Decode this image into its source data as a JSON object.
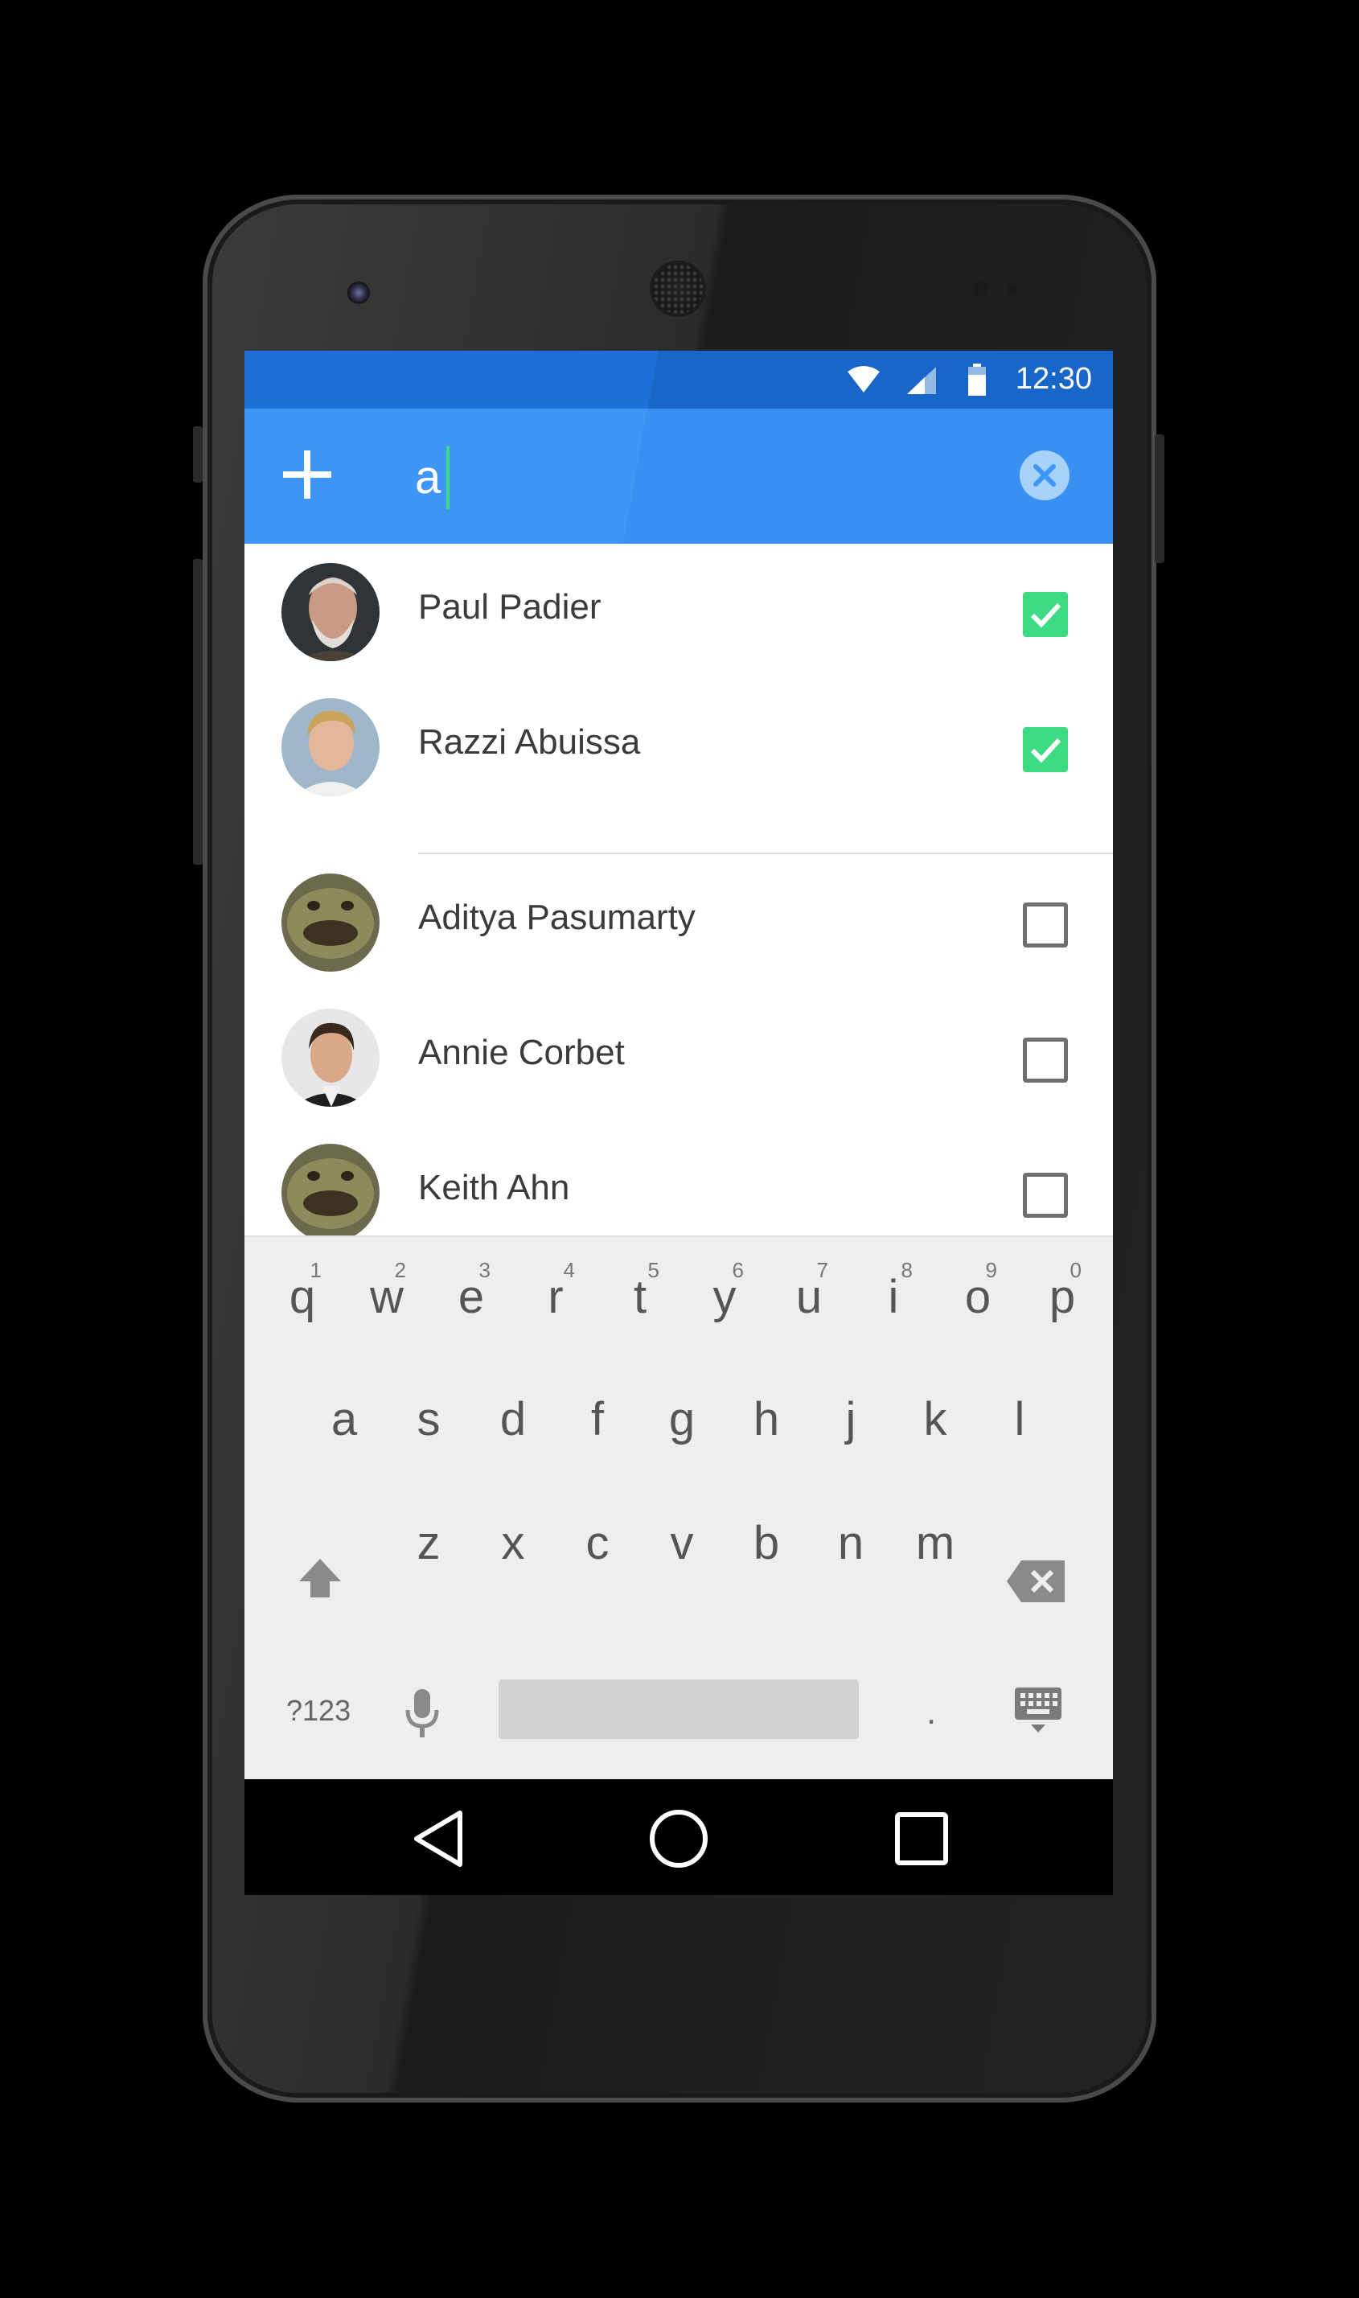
{
  "status_bar": {
    "time": "12:30"
  },
  "search": {
    "value": "a"
  },
  "contacts": [
    {
      "name": "Paul Padier",
      "checked": true
    },
    {
      "name": "Razzi Abuissa",
      "checked": true
    },
    {
      "name": "Aditya Pasumarty",
      "checked": false
    },
    {
      "name": "Annie Corbet",
      "checked": false
    },
    {
      "name": "Keith Ahn",
      "checked": false
    }
  ],
  "keyboard": {
    "row1": [
      {
        "ch": "q",
        "hint": "1"
      },
      {
        "ch": "w",
        "hint": "2"
      },
      {
        "ch": "e",
        "hint": "3"
      },
      {
        "ch": "r",
        "hint": "4"
      },
      {
        "ch": "t",
        "hint": "5"
      },
      {
        "ch": "y",
        "hint": "6"
      },
      {
        "ch": "u",
        "hint": "7"
      },
      {
        "ch": "i",
        "hint": "8"
      },
      {
        "ch": "o",
        "hint": "9"
      },
      {
        "ch": "p",
        "hint": "0"
      }
    ],
    "row2": [
      "a",
      "s",
      "d",
      "f",
      "g",
      "h",
      "j",
      "k",
      "l"
    ],
    "row3": [
      "z",
      "x",
      "c",
      "v",
      "b",
      "n",
      "m"
    ],
    "symbols_label": "?123",
    "period_label": "."
  },
  "colors": {
    "app_bar": "#3e97f7",
    "status_bar": "#1d70d8",
    "checkbox_checked": "#3ddc84",
    "keyboard_bg": "#eeeeee"
  },
  "icons": {
    "add": "plus-icon",
    "clear": "close-circle-icon",
    "shift": "shift-icon",
    "backspace": "backspace-icon",
    "mic": "microphone-icon",
    "hide_keyboard": "keyboard-hide-icon",
    "back": "back-triangle-icon",
    "home": "home-circle-icon",
    "recents": "recents-square-icon"
  }
}
